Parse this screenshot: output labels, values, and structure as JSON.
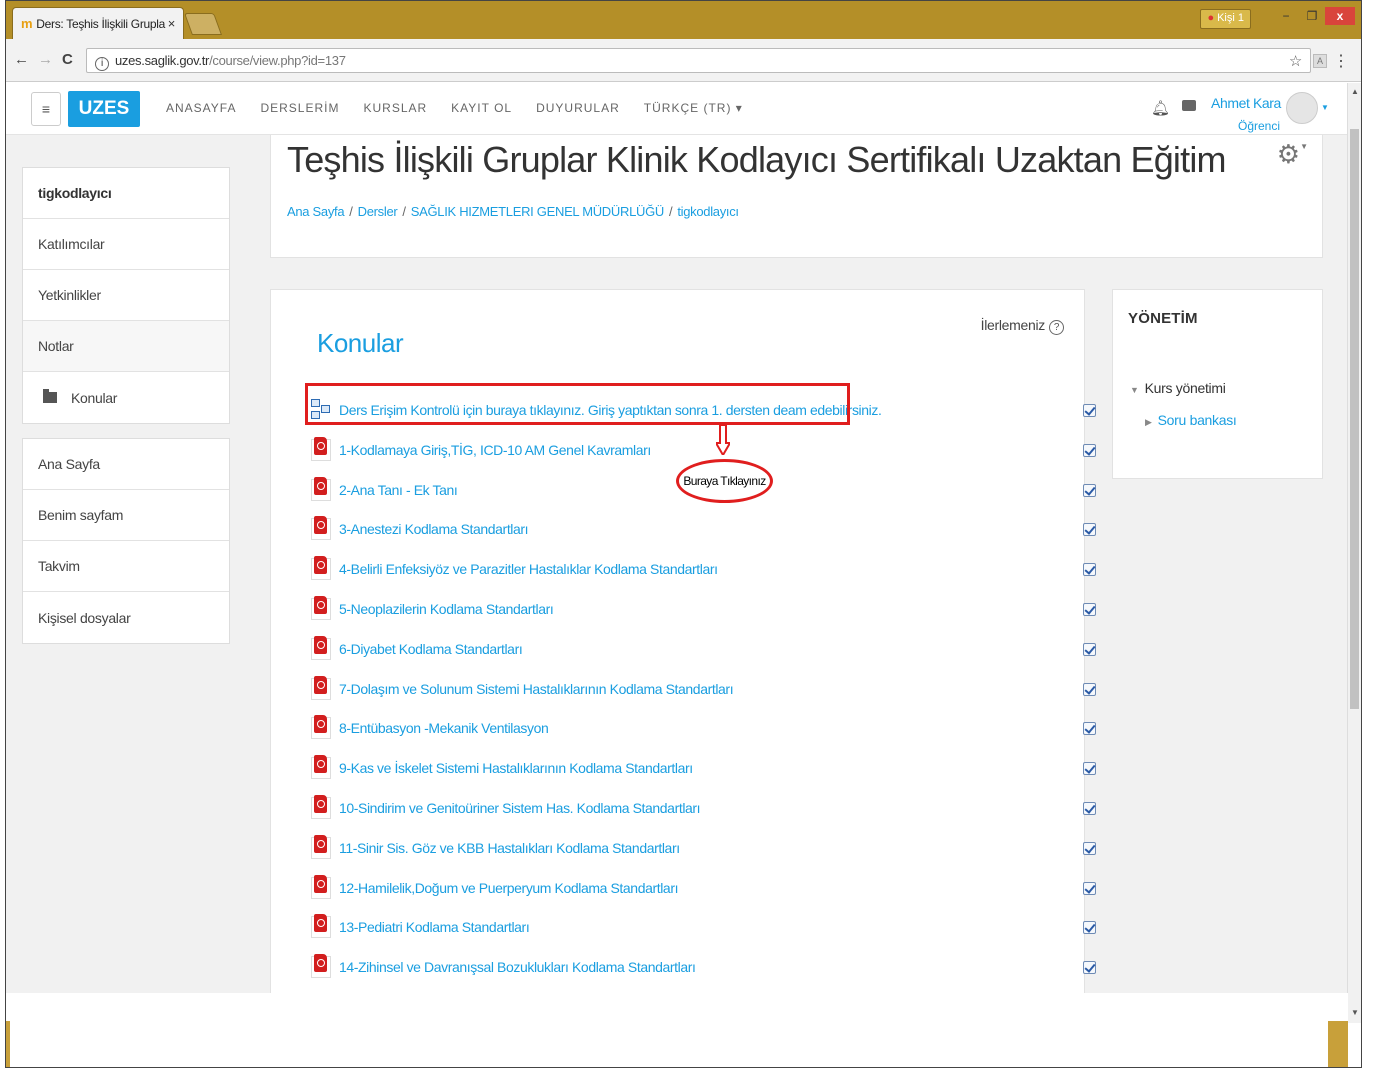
{
  "browser": {
    "tab_title": "Ders: Teşhis İlişkili Grupla",
    "tab_close": "×",
    "profile": "Kişi 1",
    "url_host": "uzes.saglik.gov.tr",
    "url_path": "/course/view.php?id=137",
    "back": "←",
    "forward": "→",
    "reload": "C",
    "star": "☆",
    "menu": "⋮",
    "min": "−",
    "max": "❐",
    "close": "x"
  },
  "navbar": {
    "hamburger": "≡",
    "brand": "UZES",
    "links": [
      "ANASAYFA",
      "DERSLERİM",
      "KURSLAR",
      "KAYIT OL",
      "DUYURULAR",
      "TÜRKÇE (TR) ▾"
    ],
    "user_name": "Ahmet Kara",
    "user_role": "Öğrenci",
    "bell_icon": "bell-icon",
    "chat_icon": "chat-icon"
  },
  "sidebar": {
    "block1": [
      {
        "label": "tigkodlayıcı",
        "style": "bold"
      },
      {
        "label": "Katılımcılar",
        "style": "normal"
      },
      {
        "label": "Yetkinlikler",
        "style": "normal"
      },
      {
        "label": "Notlar",
        "style": "grey"
      },
      {
        "label": "Konular",
        "style": "folder"
      }
    ],
    "block2": [
      {
        "label": "Ana Sayfa"
      },
      {
        "label": "Benim sayfam"
      },
      {
        "label": "Takvim"
      },
      {
        "label": "Kişisel dosyalar"
      }
    ]
  },
  "header": {
    "title": "Teşhis İlişkili Gruplar Klinik Kodlayıcı Sertifikalı Uzaktan Eğitim",
    "breadcrumb": [
      "Ana Sayfa",
      "Dersler",
      "SAĞLIK HIZMETLERI GENEL MÜDÜRLÜĞÜ",
      "tigkodlayıcı"
    ],
    "breadcrumb_sep": "/"
  },
  "main": {
    "progress_label": "İlerlemeniz",
    "section_title": "Konular",
    "activities": [
      {
        "label": "Ders Erişim Kontrolü için buraya tıklayınız. Giriş yaptıktan sonra 1. dersten deam edebilirsiniz.",
        "icon": "lti"
      },
      {
        "label": "1-Kodlamaya Giriş,TİG, ICD-10 AM Genel Kavramları",
        "icon": "pdf"
      },
      {
        "label": "2-Ana Tanı - Ek Tanı",
        "icon": "pdf"
      },
      {
        "label": "3-Anestezi Kodlama Standartları",
        "icon": "pdf"
      },
      {
        "label": "4-Belirli Enfeksiyöz ve Parazitler Hastalıklar Kodlama Standartları",
        "icon": "pdf"
      },
      {
        "label": "5-Neoplazilerin Kodlama Standartları",
        "icon": "pdf"
      },
      {
        "label": "6-Diyabet Kodlama Standartları",
        "icon": "pdf"
      },
      {
        "label": "7-Dolaşım ve Solunum Sistemi Hastalıklarının Kodlama Standartları",
        "icon": "pdf"
      },
      {
        "label": "8-Entübasyon -Mekanik Ventilasyon",
        "icon": "pdf"
      },
      {
        "label": "9-Kas ve İskelet Sistemi Hastalıklarının Kodlama Standartları",
        "icon": "pdf"
      },
      {
        "label": "10-Sindirim ve Genitoüriner Sistem Has. Kodlama Standartları",
        "icon": "pdf"
      },
      {
        "label": "11-Sinir Sis. Göz ve KBB Hastalıkları Kodlama Standartları",
        "icon": "pdf"
      },
      {
        "label": "12-Hamilelik,Doğum ve Puerperyum Kodlama Standartları",
        "icon": "pdf"
      },
      {
        "label": "13-Pediatri Kodlama Standartları",
        "icon": "pdf"
      },
      {
        "label": "14-Zihinsel ve Davranışsal Bozuklukları Kodlama Standartları",
        "icon": "pdf"
      }
    ],
    "annotation": "Buraya Tıklayınız"
  },
  "admin_block": {
    "title": "YÖNETİM",
    "course_admin": "Kurs yönetimi",
    "question_bank": "Soru bankası"
  },
  "colors": {
    "accent": "#1a9ee0",
    "annotation": "#e01e1e",
    "tabstrip": "#b48f28"
  }
}
